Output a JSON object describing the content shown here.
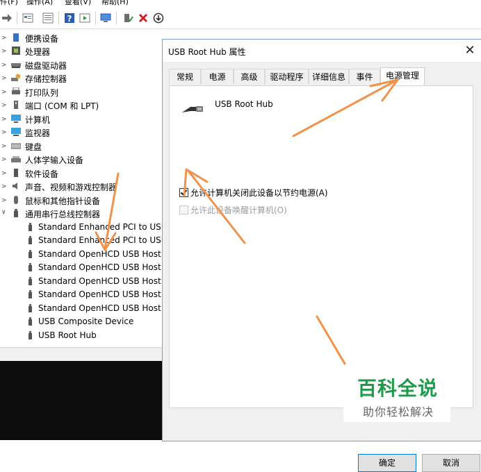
{
  "menu": [
    "件(F)",
    "操作(A)",
    "查看(V)",
    "帮助(H)"
  ],
  "toolbar_icons": [
    "forward-icon",
    "properties-icon",
    "view-icon",
    "help-icon",
    "run-icon",
    "scan-icon",
    "enable-icon",
    "uninstall-icon",
    "update-driver-icon"
  ],
  "tree": {
    "categories": [
      {
        "label": "便携设备",
        "icon": "portable-device-icon"
      },
      {
        "label": "处理器",
        "icon": "processor-icon"
      },
      {
        "label": "磁盘驱动器",
        "icon": "disk-drive-icon"
      },
      {
        "label": "存储控制器",
        "icon": "storage-controller-icon"
      },
      {
        "label": "打印队列",
        "icon": "print-queue-icon"
      },
      {
        "label": "端口 (COM 和 LPT)",
        "icon": "port-icon"
      },
      {
        "label": "计算机",
        "icon": "computer-icon"
      },
      {
        "label": "监视器",
        "icon": "monitor-icon"
      },
      {
        "label": "键盘",
        "icon": "keyboard-icon"
      },
      {
        "label": "人体学输入设备",
        "icon": "hid-icon"
      },
      {
        "label": "软件设备",
        "icon": "software-device-icon"
      },
      {
        "label": "声音、视频和游戏控制器",
        "icon": "sound-icon"
      },
      {
        "label": "鼠标和其他指针设备",
        "icon": "mouse-icon"
      },
      {
        "label": "通用串行总线控制器",
        "icon": "usb-icon"
      }
    ],
    "usb_children": [
      "Standard Enhanced PCI to USB",
      "Standard Enhanced PCI to USB",
      "Standard OpenHCD USB Host C",
      "Standard OpenHCD USB Host C",
      "Standard OpenHCD USB Host C",
      "Standard OpenHCD USB Host C",
      "Standard OpenHCD USB Host C",
      "USB Composite Device",
      "USB Root Hub"
    ]
  },
  "dialog": {
    "title": "USB Root Hub 属性",
    "close": "✕",
    "tabs": [
      "常规",
      "电源",
      "高级",
      "驱动程序",
      "详细信息",
      "事件",
      "电源管理"
    ],
    "active_tab": "电源管理",
    "device_name": "USB Root Hub",
    "option_allow_off": {
      "label": "允许计算机关闭此设备以节约电源(A)",
      "checked": true
    },
    "option_wake": {
      "label": "允许此设备唤醒计算机(O)",
      "checked": false,
      "disabled": true
    },
    "ok": "确定",
    "cancel": "取消"
  },
  "watermark": {
    "main": "百科全说",
    "sub": "助你轻松解决"
  },
  "colors": {
    "arrow": "#f0924a",
    "watermark_green": "#1e9a4a",
    "accent_blue": "#0078d7"
  }
}
